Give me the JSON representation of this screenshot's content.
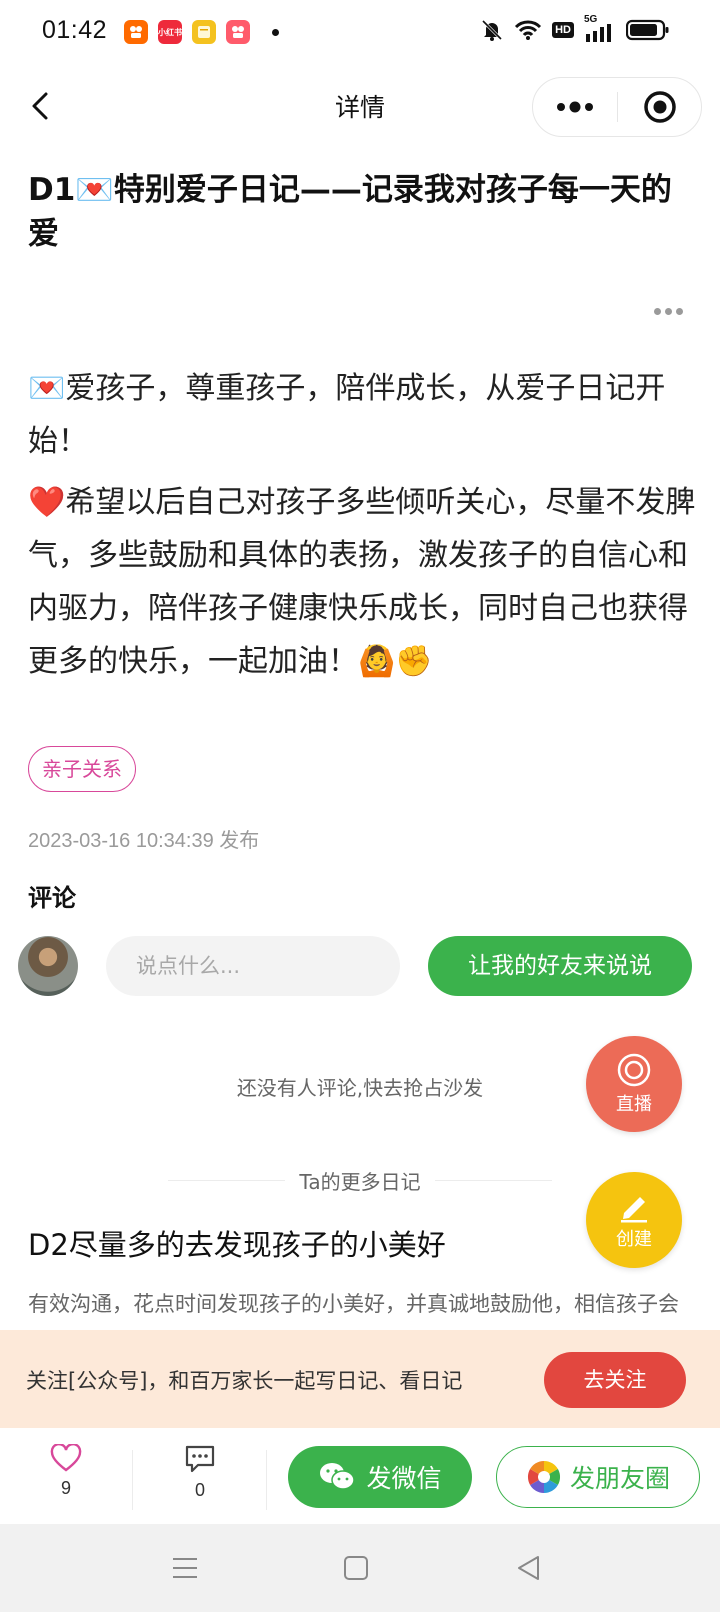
{
  "status_bar": {
    "time": "01:42",
    "apps": [
      {
        "name": "kuaishou",
        "color": "#ff6a00"
      },
      {
        "name": "xiaohongshu",
        "text": "小红书",
        "color": "#ee2a3b"
      },
      {
        "name": "notes",
        "color": "#f4c21f"
      },
      {
        "name": "kuaishou-2",
        "color": "#ff5b6b"
      }
    ],
    "network": "5G",
    "hd": "HD"
  },
  "navbar": {
    "title": "详情"
  },
  "article": {
    "title": "D1💌特别爱子日记——记录我对孩子每一天的爱",
    "paragraph_1": "💌爱孩子，尊重孩子，陪伴成长，从爱子日记开始！",
    "paragraph_2": "❤️希望以后自己对孩子多些倾听关心，尽量不发脾气，多些鼓励和具体的表扬，激发孩子的自信心和内驱力，陪伴孩子健康快乐成长，同时自己也获得更多的快乐，一起加油！🙆✊",
    "tag": "亲子关系",
    "published_time": "2023-03-16 10:34:39",
    "published_suffix": "发布"
  },
  "comments": {
    "title": "评论",
    "input_placeholder": "说点什么...",
    "invite_button": "让我的好友来说说",
    "empty_text": "还没有人评论,快去抢占沙发"
  },
  "fabs": {
    "live_label": "直播",
    "create_label": "创建"
  },
  "more_diaries": {
    "divider_label": "Ta的更多日记",
    "item_title": "D2尽量多的去发现孩子的小美好",
    "item_excerpt": "有效沟通，花点时间发现孩子的小美好，并真诚地鼓励他，相信孩子会朝着想要的样子慢慢成长！⭐孩子的优点，乐观开"
  },
  "follow_banner": {
    "text": "关注[公众号]，和百万家长一起写日记、看日记",
    "button": "去关注"
  },
  "action_bar": {
    "likes": "9",
    "comments": "0",
    "wechat_button": "发微信",
    "moments_button": "发朋友圈"
  },
  "colors": {
    "green": "#3bb24c",
    "tag_pink": "#d8489a",
    "follow_red": "#e2473f",
    "live_orange": "#ec6b57",
    "create_yellow": "#f5c40f"
  }
}
